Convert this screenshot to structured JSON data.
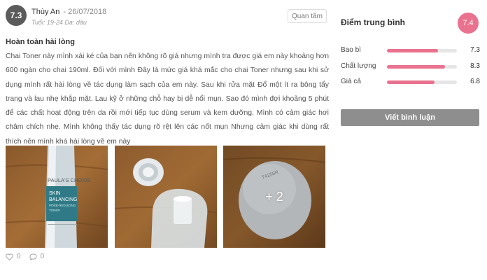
{
  "review": {
    "score": "7.3",
    "author": "Thùy An",
    "date": "- 26/07/2018",
    "meta": "Tuổi: 19-24  Da: dầu",
    "follow_label": "Quan tâm",
    "title": "Hoàn toàn hài lòng",
    "body": "Chai Toner này mình xài ké của bạn nên không rõ giá nhưng mình tra được giá em này khoảng hơn 600 ngàn cho chai 190ml. Đối với mình Đây là mức giá khá mắc cho chai Toner nhưng sau khi sử dụng mình rất hài lòng về tác dụng làm sạch của em này. Sau khi rửa mặt Đổ một ít ra bông tẩy trang và lau nhẹ khắp mặt. Lau kỹ ở những chỗ hay bị dễ nổi mụn. Sao đó mình đợi khoảng 5 phút để các chất hoạt động trên da rồi mới tiếp tục dùng serum và kem dưỡng. Mình có cảm giác hơi châm chích nhẹ. Mình không thấy tác dụng rõ rệt lên các nốt mụn Nhưng cảm giác khi dùng rất thích nên mình khá hài lòng về em này",
    "photos": {
      "bottle_brand": "PAULA'S CHOICE",
      "bottle_line1": "SKIN",
      "bottle_line2": "BALANCING",
      "bottle_line3": "PORE-REDUCING",
      "bottle_line4": "TONER",
      "cap_code": "T4256R",
      "more_count": "+ 2"
    },
    "likes": "0",
    "comments": "0"
  },
  "sidebar": {
    "title": "Điểm trung bình",
    "average": "7.4",
    "ratings": [
      {
        "label": "Bao bì",
        "value": "7.3",
        "fraction": 0.73
      },
      {
        "label": "Chất lượng",
        "value": "8.3",
        "fraction": 0.83
      },
      {
        "label": "Giá cả",
        "value": "6.8",
        "fraction": 0.68
      }
    ],
    "write_label": "Viết bình luận"
  },
  "colors": {
    "accent": "#e9728e",
    "score_badge": "#5b5b5b",
    "button_gray": "#8e8e8e"
  }
}
